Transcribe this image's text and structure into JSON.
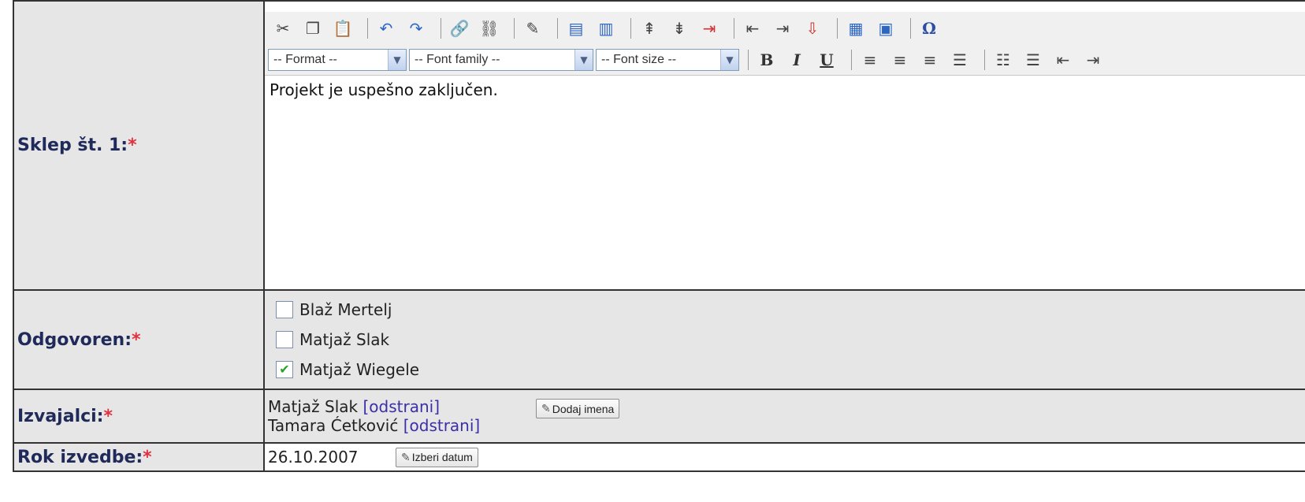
{
  "toolbar": {
    "row1_icons": [
      "cut-icon",
      "copy-icon",
      "paste-icon",
      "undo-icon",
      "redo-icon",
      "link-icon",
      "unlink-icon",
      "edit-html-icon",
      "table-row-icon",
      "table-col-icon",
      "insert-row-before-icon",
      "insert-row-after-icon",
      "delete-row-icon",
      "insert-col-before-icon",
      "insert-col-after-icon",
      "delete-col-icon",
      "table-icon",
      "table-props-icon",
      "special-char-icon"
    ],
    "format_select": "-- Format --",
    "font_family_select": "-- Font family --",
    "font_size_select": "-- Font size --",
    "bold": "B",
    "italic": "I",
    "underline": "U",
    "special_char": "Ω"
  },
  "rows": {
    "sklep": {
      "label": "Sklep št. 1:",
      "required_mark": "*",
      "content": "Projekt je uspešno zaključen."
    },
    "odgovoren": {
      "label": "Odgovoren:",
      "required_mark": "*",
      "options": [
        {
          "name": "Blaž Mertelj",
          "checked": false
        },
        {
          "name": "Matjaž Slak",
          "checked": false
        },
        {
          "name": "Matjaž Wiegele",
          "checked": true
        }
      ]
    },
    "izvajalci": {
      "label": "Izvajalci:",
      "required_mark": "*",
      "people": [
        {
          "name": "Matjaž Slak",
          "action": "[odstrani]"
        },
        {
          "name": "Tamara Ćetković",
          "action": "[odstrani]"
        }
      ],
      "add_button": "Dodaj imena"
    },
    "rok": {
      "label": "Rok izvedbe:",
      "required_mark": "*",
      "date": "26.10.2007",
      "pick_button": "Izberi datum"
    }
  }
}
